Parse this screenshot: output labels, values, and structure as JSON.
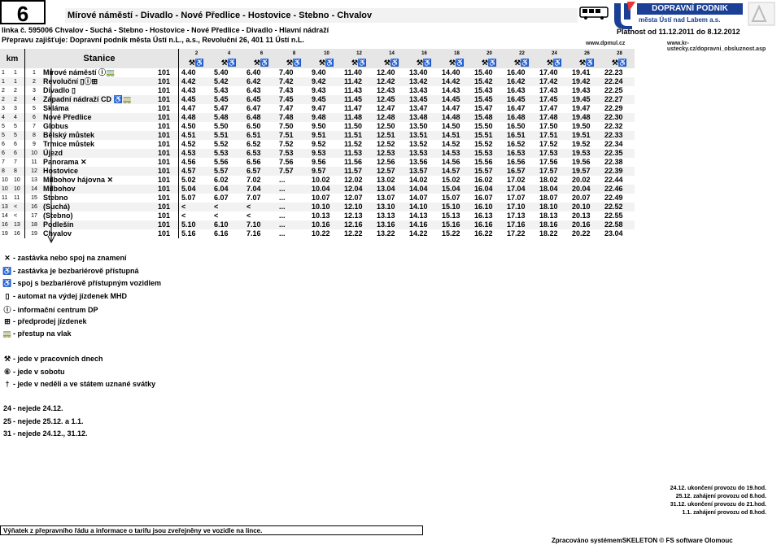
{
  "header": {
    "line_number": "6",
    "route_title": "Mírové náměstí - Divadlo - Nové Předlice - Hostovice - Stebno - Chvalov",
    "line_info": "linka č. 595006 Chvalov - Suchá - Stebno - Hostovice - Nové Předlice - Divadlo - Hlavní nádraží",
    "carrier_info": "Přepravu zajišťuje: Dopravní podnik města Ústí n.L., a.s., Revoluční 26, 401 11 Ústí n.L.",
    "validity": "Platnost od 11.12.2011 do 8.12.2012",
    "web_left": "www.dpmul.cz",
    "web_right": "www.kr-ustecky.cz/dopravni_obsluznost.asp",
    "logo_title": "DOPRAVNÍ PODNIK",
    "logo_subtitle": "města Ústí nad Labem a.s."
  },
  "table": {
    "col_km": "km",
    "col_stop": "Stanice",
    "trip_numbers": [
      "2",
      "4",
      "6",
      "8",
      "10",
      "12",
      "14",
      "16",
      "18",
      "20",
      "22",
      "24",
      "26",
      "28"
    ],
    "trip_icon": "⚒♿",
    "stops": [
      {
        "km1": "1",
        "km2": "1",
        "ord": "1",
        "name": "Mírové náměstí ⓘ🚃",
        "zone": "101",
        "times": [
          "4.40",
          "5.40",
          "6.40",
          "7.40",
          "9.40",
          "11.40",
          "12.40",
          "13.40",
          "14.40",
          "15.40",
          "16.40",
          "17.40",
          "19.41",
          "22.23"
        ]
      },
      {
        "km1": "1",
        "km2": "1",
        "ord": "2",
        "name": "Revoluční ▯ⓘ⊞",
        "zone": "101",
        "times": [
          "4.42",
          "5.42",
          "6.42",
          "7.42",
          "9.42",
          "11.42",
          "12.42",
          "13.42",
          "14.42",
          "15.42",
          "16.42",
          "17.42",
          "19.42",
          "22.24"
        ]
      },
      {
        "km1": "2",
        "km2": "2",
        "ord": "3",
        "name": "Divadlo ▯",
        "zone": "101",
        "times": [
          "4.43",
          "5.43",
          "6.43",
          "7.43",
          "9.43",
          "11.43",
          "12.43",
          "13.43",
          "14.43",
          "15.43",
          "16.43",
          "17.43",
          "19.43",
          "22.25"
        ]
      },
      {
        "km1": "2",
        "km2": "2",
        "ord": "4",
        "name": "Západní nádraží CD ♿🚃",
        "zone": "101",
        "times": [
          "4.45",
          "5.45",
          "6.45",
          "7.45",
          "9.45",
          "11.45",
          "12.45",
          "13.45",
          "14.45",
          "15.45",
          "16.45",
          "17.45",
          "19.45",
          "22.27"
        ]
      },
      {
        "km1": "3",
        "km2": "3",
        "ord": "5",
        "name": "Skláma",
        "zone": "101",
        "times": [
          "4.47",
          "5.47",
          "6.47",
          "7.47",
          "9.47",
          "11.47",
          "12.47",
          "13.47",
          "14.47",
          "15.47",
          "16.47",
          "17.47",
          "19.47",
          "22.29"
        ]
      },
      {
        "km1": "4",
        "km2": "4",
        "ord": "6",
        "name": "Nové Předlice",
        "zone": "101",
        "times": [
          "4.48",
          "5.48",
          "6.48",
          "7.48",
          "9.48",
          "11.48",
          "12.48",
          "13.48",
          "14.48",
          "15.48",
          "16.48",
          "17.48",
          "19.48",
          "22.30"
        ]
      },
      {
        "km1": "5",
        "km2": "5",
        "ord": "7",
        "name": "Globus",
        "zone": "101",
        "times": [
          "4.50",
          "5.50",
          "6.50",
          "7.50",
          "9.50",
          "11.50",
          "12.50",
          "13.50",
          "14.50",
          "15.50",
          "16.50",
          "17.50",
          "19.50",
          "22.32"
        ]
      },
      {
        "km1": "5",
        "km2": "5",
        "ord": "8",
        "name": "Bělský můstek",
        "zone": "101",
        "times": [
          "4.51",
          "5.51",
          "6.51",
          "7.51",
          "9.51",
          "11.51",
          "12.51",
          "13.51",
          "14.51",
          "15.51",
          "16.51",
          "17.51",
          "19.51",
          "22.33"
        ]
      },
      {
        "km1": "6",
        "km2": "6",
        "ord": "9",
        "name": "Trmice můstek",
        "zone": "101",
        "times": [
          "4.52",
          "5.52",
          "6.52",
          "7.52",
          "9.52",
          "11.52",
          "12.52",
          "13.52",
          "14.52",
          "15.52",
          "16.52",
          "17.52",
          "19.52",
          "22.34"
        ]
      },
      {
        "km1": "6",
        "km2": "6",
        "ord": "10",
        "name": "Újezd",
        "zone": "101",
        "times": [
          "4.53",
          "5.53",
          "6.53",
          "7.53",
          "9.53",
          "11.53",
          "12.53",
          "13.53",
          "14.53",
          "15.53",
          "16.53",
          "17.53",
          "19.53",
          "22.35"
        ]
      },
      {
        "km1": "7",
        "km2": "7",
        "ord": "11",
        "name": "Panorama ✕",
        "zone": "101",
        "times": [
          "4.56",
          "5.56",
          "6.56",
          "7.56",
          "9.56",
          "11.56",
          "12.56",
          "13.56",
          "14.56",
          "15.56",
          "16.56",
          "17.56",
          "19.56",
          "22.38"
        ]
      },
      {
        "km1": "8",
        "km2": "8",
        "ord": "12",
        "name": "Hostovice",
        "zone": "101",
        "times": [
          "4.57",
          "5.57",
          "6.57",
          "7.57",
          "9.57",
          "11.57",
          "12.57",
          "13.57",
          "14.57",
          "15.57",
          "16.57",
          "17.57",
          "19.57",
          "22.39"
        ]
      },
      {
        "km1": "10",
        "km2": "10",
        "ord": "13",
        "name": "Milbohov hájovna ✕",
        "zone": "101",
        "times": [
          "5.02",
          "6.02",
          "7.02",
          "...",
          "10.02",
          "12.02",
          "13.02",
          "14.02",
          "15.02",
          "16.02",
          "17.02",
          "18.02",
          "20.02",
          "22.44"
        ]
      },
      {
        "km1": "10",
        "km2": "10",
        "ord": "14",
        "name": "Milbohov",
        "zone": "101",
        "times": [
          "5.04",
          "6.04",
          "7.04",
          "...",
          "10.04",
          "12.04",
          "13.04",
          "14.04",
          "15.04",
          "16.04",
          "17.04",
          "18.04",
          "20.04",
          "22.46"
        ]
      },
      {
        "km1": "11",
        "km2": "11",
        "ord": "15",
        "name": "Stebno",
        "zone": "101",
        "times": [
          "5.07",
          "6.07",
          "7.07",
          "...",
          "10.07",
          "12.07",
          "13.07",
          "14.07",
          "15.07",
          "16.07",
          "17.07",
          "18.07",
          "20.07",
          "22.49"
        ]
      },
      {
        "km1": "13",
        "km2": "<",
        "ord": "16",
        "name": "  (Suchá)",
        "zone": "101",
        "times": [
          "<",
          "<",
          "<",
          "...",
          "10.10",
          "12.10",
          "13.10",
          "14.10",
          "15.10",
          "16.10",
          "17.10",
          "18.10",
          "20.10",
          "22.52"
        ]
      },
      {
        "km1": "14",
        "km2": "<",
        "ord": "17",
        "name": "  (Stebno)",
        "zone": "101",
        "times": [
          "<",
          "<",
          "<",
          "...",
          "10.13",
          "12.13",
          "13.13",
          "14.13",
          "15.13",
          "16.13",
          "17.13",
          "18.13",
          "20.13",
          "22.55"
        ]
      },
      {
        "km1": "16",
        "km2": "13",
        "ord": "18",
        "name": "Podlešín",
        "zone": "101",
        "times": [
          "5.10",
          "6.10",
          "7.10",
          "...",
          "10.16",
          "12.16",
          "13.16",
          "14.16",
          "15.16",
          "16.16",
          "17.16",
          "18.16",
          "20.16",
          "22.58"
        ]
      },
      {
        "km1": "19",
        "km2": "16",
        "ord": "19",
        "name": "Chvalov",
        "zone": "101",
        "times": [
          "5.16",
          "6.16",
          "7.16",
          "...",
          "10.22",
          "12.22",
          "13.22",
          "14.22",
          "15.22",
          "16.22",
          "17.22",
          "18.22",
          "20.22",
          "23.04"
        ]
      }
    ]
  },
  "legend": [
    {
      "icon": "✕",
      "text": "- zastávka nebo spoj na znamení"
    },
    {
      "icon": "♿",
      "text": "- zastávka je bezbariérově přístupná"
    },
    {
      "icon": "♿",
      "text": "- spoj s bezbariérově přístupným vozidlem"
    },
    {
      "icon": "▯",
      "text": "- automat na výdej jízdenek MHD"
    },
    {
      "icon": "ⓘ",
      "text": "- informační centrum DP"
    },
    {
      "icon": "⊞",
      "text": "- předprodej jízdenek"
    },
    {
      "icon": "🚃",
      "text": "- přestup na vlak"
    }
  ],
  "legend2": [
    {
      "icon": "⚒",
      "text": "- jede v pracovních dnech"
    },
    {
      "icon": "⑥",
      "text": "- jede v sobotu"
    },
    {
      "icon": "†",
      "text": "- jede v neděli a ve státem uznané svátky"
    }
  ],
  "legend3": [
    {
      "icon": "24",
      "text": "- nejede 24.12."
    },
    {
      "icon": "25",
      "text": "- nejede 25.12. a 1.1."
    },
    {
      "icon": "31",
      "text": "- nejede 24.12., 31.12."
    }
  ],
  "notes": [
    "24.12. ukončení provozu do 19.hod.",
    "25.12. zahájení provozu od 8.hod.",
    "31.12. ukončení provozu do 21.hod.",
    "1.1. zahájení provozu od 8.hod."
  ],
  "bottom_box": "Výňatek z přepravního řádu a informace o tarifu jsou zveřejněny ve vozidle na lince.",
  "footer": "Zpracováno systémemSKELETON © FS software Olomouc"
}
